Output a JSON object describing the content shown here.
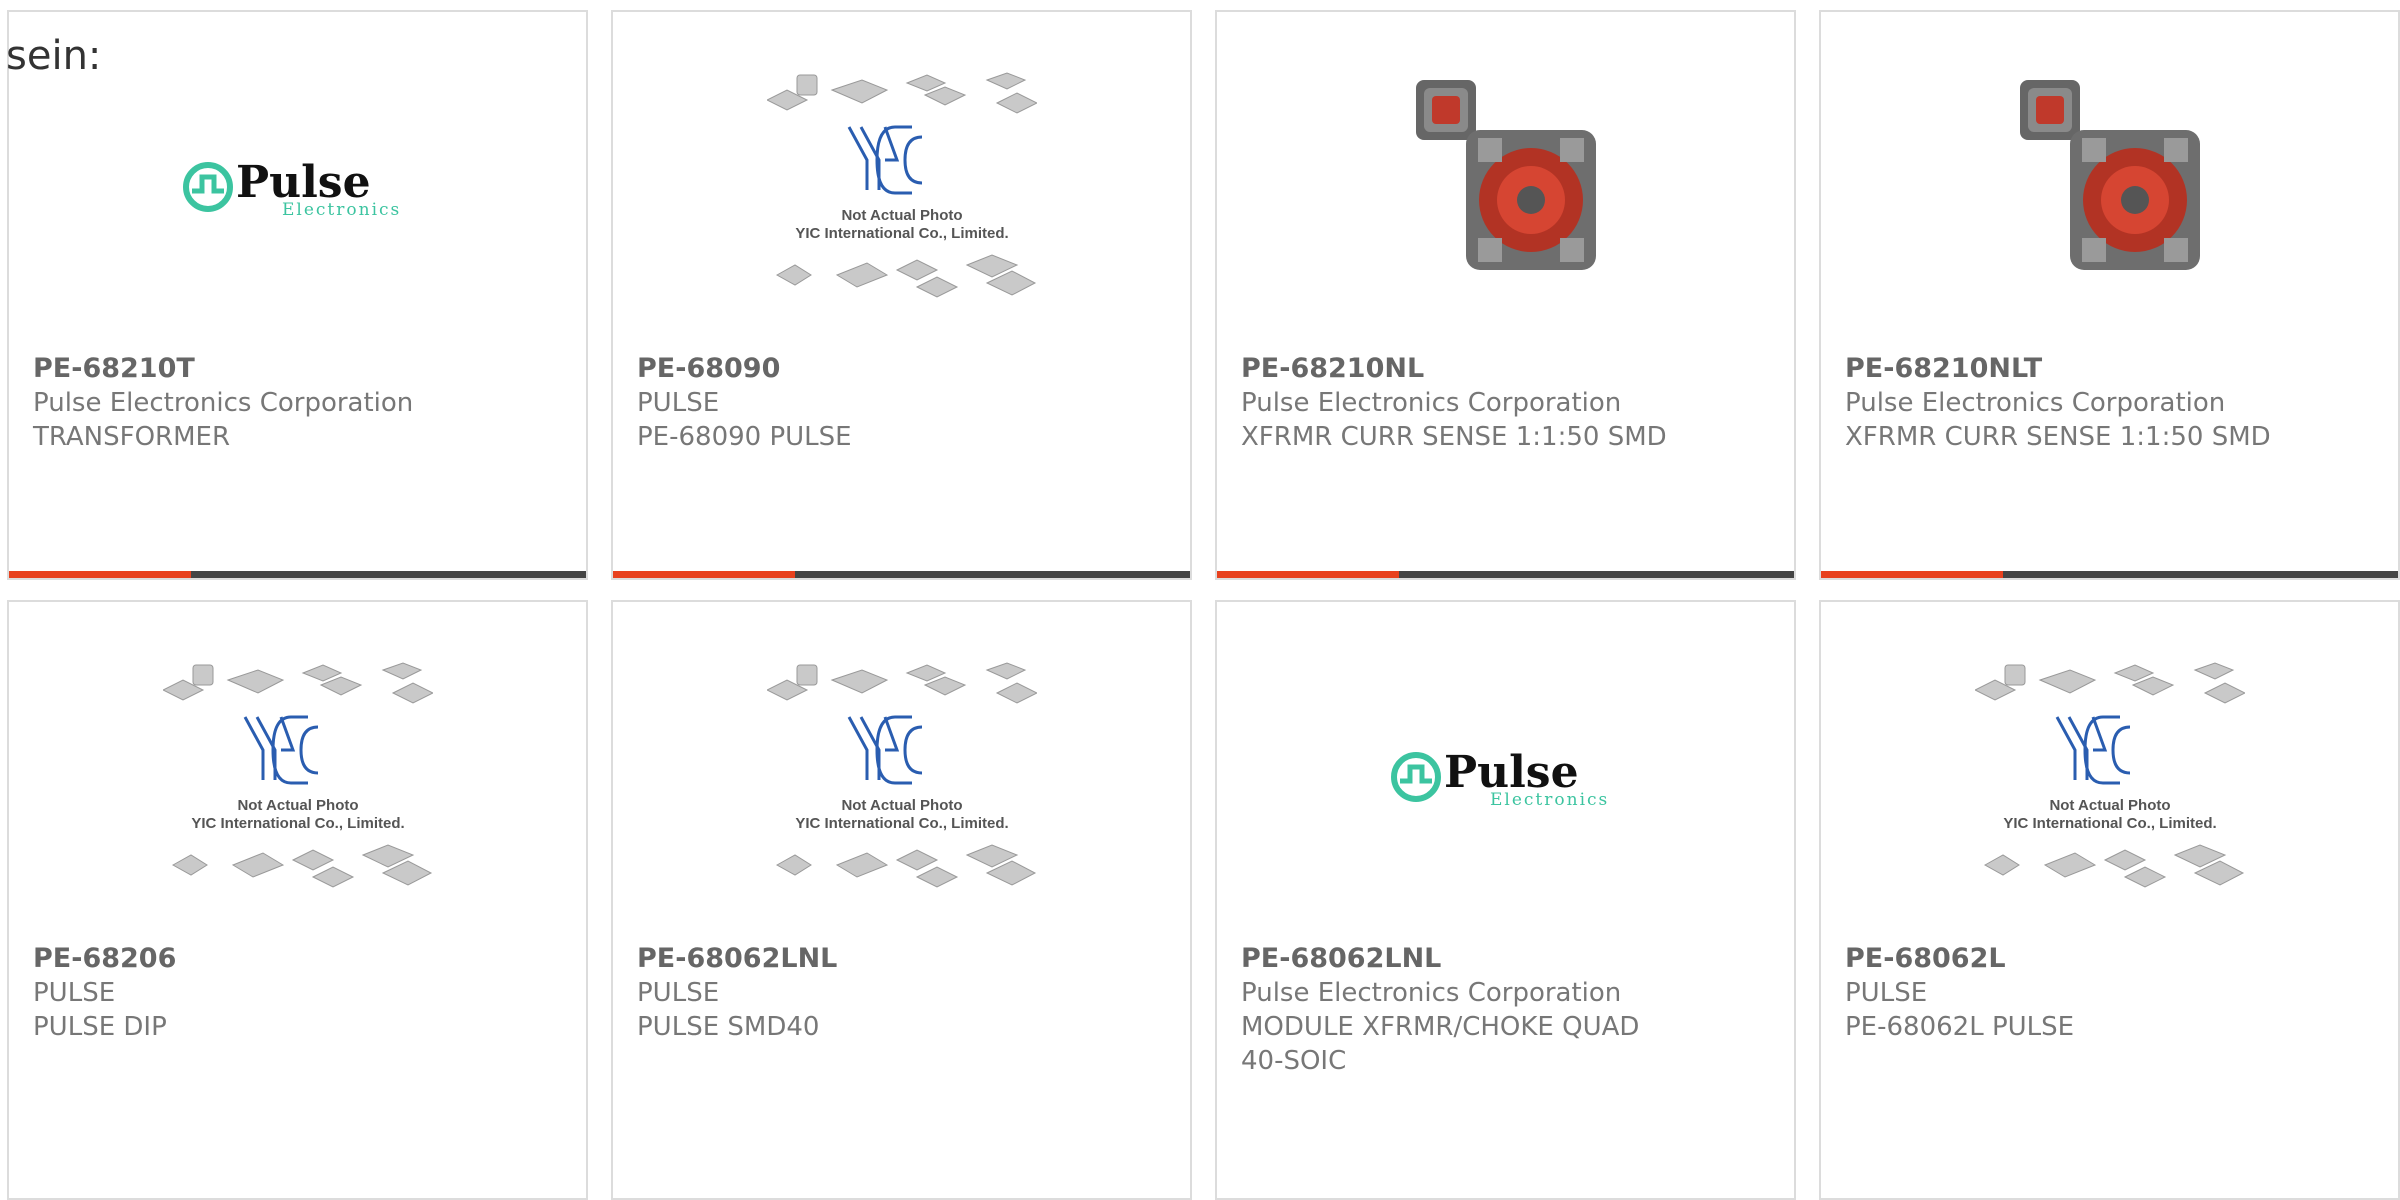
{
  "intro_text": "sein:",
  "colors": {
    "accent": "#e8411e",
    "bar": "#444444",
    "pulse_green": "#3cc4a0",
    "yic_blue": "#2a5db0"
  },
  "products": [
    {
      "part": "PE-68210T",
      "manufacturer": "Pulse Electronics Corporation",
      "description": "TRANSFORMER",
      "image": "pulse-logo",
      "logo_word": "Pulse",
      "logo_sub": "Electronics"
    },
    {
      "part": "PE-68090",
      "manufacturer": "PULSE",
      "description": "PE-68090 PULSE",
      "image": "yic-placeholder",
      "placeholder_line1": "Not Actual Photo",
      "placeholder_line2": "YIC International Co., Limited."
    },
    {
      "part": "PE-68210NL",
      "manufacturer": "Pulse Electronics Corporation",
      "description": "XFRMR CURR SENSE 1:1:50 SMD",
      "image": "inductor-photo"
    },
    {
      "part": "PE-68210NLT",
      "manufacturer": "Pulse Electronics Corporation",
      "description": "XFRMR CURR SENSE 1:1:50 SMD",
      "image": "inductor-photo"
    },
    {
      "part": "PE-68206",
      "manufacturer": "PULSE",
      "description": "PULSE DIP",
      "image": "yic-placeholder",
      "placeholder_line1": "Not Actual Photo",
      "placeholder_line2": "YIC International Co., Limited."
    },
    {
      "part": "PE-68062LNL",
      "manufacturer": "PULSE",
      "description": "PULSE SMD40",
      "image": "yic-placeholder",
      "placeholder_line1": "Not Actual Photo",
      "placeholder_line2": "YIC International Co., Limited."
    },
    {
      "part": "PE-68062LNL",
      "manufacturer": "Pulse Electronics Corporation",
      "description": "MODULE XFRMR/CHOKE QUAD 40-SOIC",
      "image": "pulse-logo",
      "logo_word": "Pulse",
      "logo_sub": "Electronics"
    },
    {
      "part": "PE-68062L",
      "manufacturer": "PULSE",
      "description": "PE-68062L PULSE",
      "image": "yic-placeholder",
      "placeholder_line1": "Not Actual Photo",
      "placeholder_line2": "YIC International Co., Limited."
    }
  ]
}
